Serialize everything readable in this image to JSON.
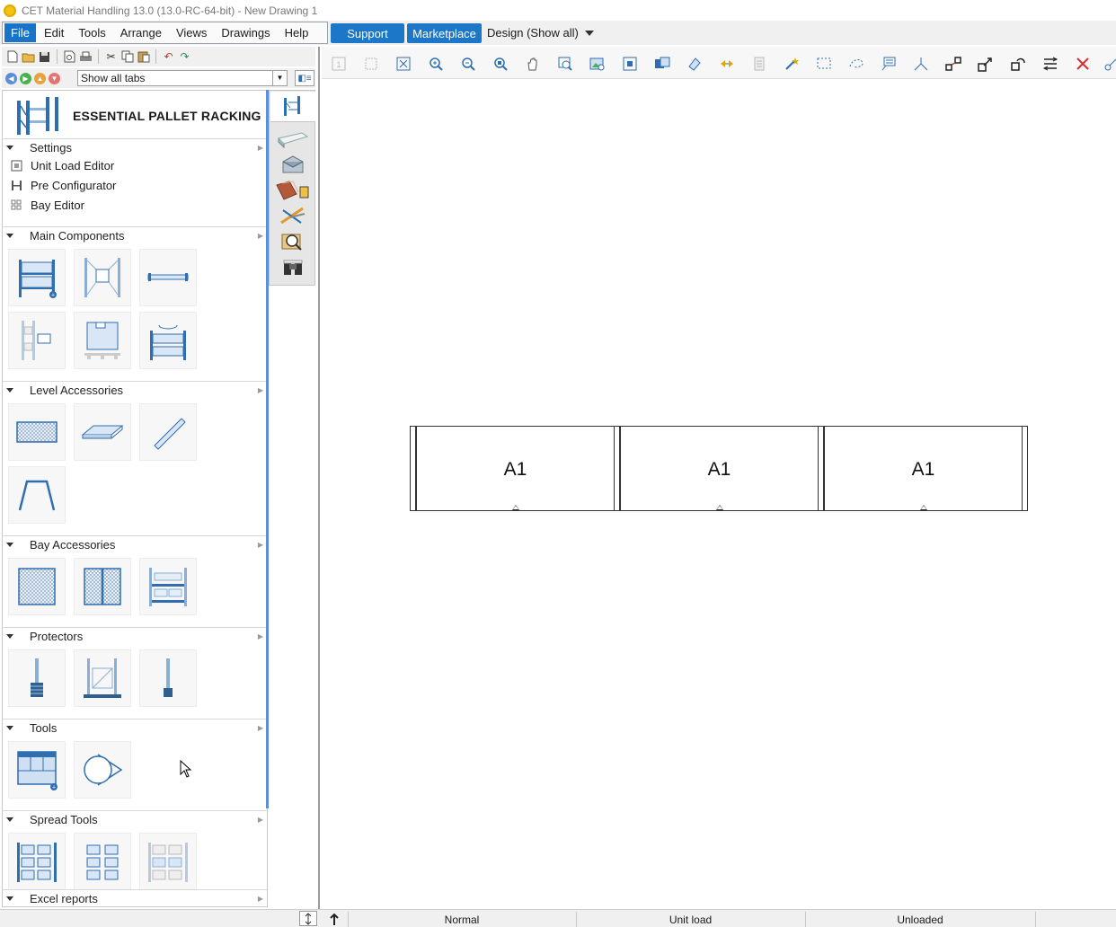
{
  "window": {
    "title": "CET Material Handling 13.0 (13.0-RC-64-bit) - New Drawing 1"
  },
  "menu": {
    "items": [
      "File",
      "Edit",
      "Tools",
      "Arrange",
      "Views",
      "Drawings",
      "Help"
    ],
    "active_index": 0
  },
  "top_buttons": {
    "support": "Support",
    "marketplace": "Marketplace"
  },
  "design_selector": {
    "value": "Design (Show all)"
  },
  "tabs_filter": {
    "value": "Show all tabs"
  },
  "panel": {
    "title": "ESSENTIAL PALLET RACKING",
    "sections": {
      "settings": {
        "label": "Settings",
        "items": [
          "Unit Load Editor",
          "Pre Configurator",
          "Bay Editor"
        ]
      },
      "main_components": {
        "label": "Main Components",
        "tiles": [
          "frame-bay-add",
          "frame-tunnel",
          "beam",
          "frame-with-box",
          "pallet-unit-load",
          "rotate-bay-180"
        ]
      },
      "level_accessories": {
        "label": "Level Accessories",
        "tiles": [
          "mesh-deck",
          "panel-deck",
          "level-bar",
          "pallet-support"
        ]
      },
      "bay_accessories": {
        "label": "Bay Accessories",
        "tiles": [
          "mesh-back",
          "mesh-back-double",
          "bay-divider"
        ]
      },
      "protectors": {
        "label": "Protectors",
        "tiles": [
          "upright-protector",
          "frame-protector",
          "post-protector"
        ]
      },
      "tools": {
        "label": "Tools",
        "tiles": [
          "layout-grid-add",
          "circle-arrow-tool"
        ]
      },
      "spread_tools": {
        "label": "Spread Tools",
        "tiles": [
          "spread-rack",
          "spread-pallet",
          "spread-shaded"
        ]
      },
      "excel_reports": {
        "label": "Excel reports"
      }
    }
  },
  "drawing": {
    "bays": [
      {
        "label": "A1"
      },
      {
        "label": "A1"
      },
      {
        "label": "A1"
      }
    ]
  },
  "status": {
    "mode": "Normal",
    "load_type": "Unit load",
    "load_state": "Unloaded"
  },
  "colors": {
    "accent": "#1d77c8",
    "menu_active": "#1874c9",
    "icon_blue": "#2f6eb0"
  }
}
